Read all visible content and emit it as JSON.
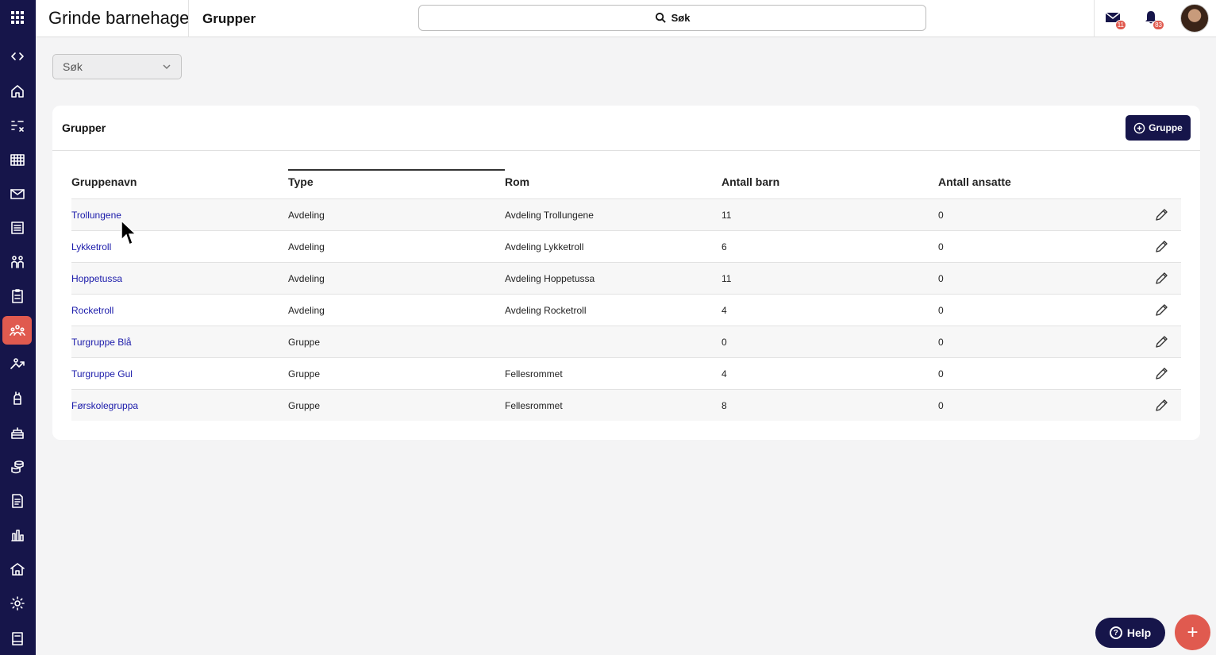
{
  "header": {
    "app_title": "Grinde barnehage",
    "page_title": "Grupper",
    "search_label": "Søk",
    "messages_badge": "11",
    "notifications_badge": "83"
  },
  "filter": {
    "selected": "Søk"
  },
  "card": {
    "title": "Grupper",
    "add_button_label": "Gruppe"
  },
  "table": {
    "columns": [
      "Gruppenavn",
      "Type",
      "Rom",
      "Antall barn",
      "Antall ansatte"
    ],
    "rows": [
      {
        "name": "Trollungene",
        "type": "Avdeling",
        "room": "Avdeling Trollungene",
        "children": "11",
        "staff": "0"
      },
      {
        "name": "Lykketroll",
        "type": "Avdeling",
        "room": "Avdeling Lykketroll",
        "children": "6",
        "staff": "0"
      },
      {
        "name": "Hoppetussa",
        "type": "Avdeling",
        "room": "Avdeling Hoppetussa",
        "children": "11",
        "staff": "0"
      },
      {
        "name": "Rocketroll",
        "type": "Avdeling",
        "room": "Avdeling Rocketroll",
        "children": "4",
        "staff": "0"
      },
      {
        "name": "Turgruppe Blå",
        "type": "Gruppe",
        "room": "",
        "children": "0",
        "staff": "0"
      },
      {
        "name": "Turgruppe Gul",
        "type": "Gruppe",
        "room": "Fellesrommet",
        "children": "4",
        "staff": "0"
      },
      {
        "name": "Førskolegruppa",
        "type": "Gruppe",
        "room": "Fellesrommet",
        "children": "8",
        "staff": "0"
      }
    ]
  },
  "floating": {
    "help_label": "Help",
    "add_symbol": "+"
  },
  "sidebar": {
    "icons": [
      "apps-grid-icon",
      "collapse-toggle-icon",
      "home-icon",
      "tasks-icon",
      "calendar-icon",
      "mail-icon",
      "news-icon",
      "children-icon",
      "checklist-icon",
      "groups-icon",
      "meals-icon",
      "activity-icon",
      "birthday-icon",
      "finance-icon",
      "documents-icon",
      "reports-icon",
      "kindergarten-icon",
      "settings-icon",
      "book-icon"
    ],
    "active": "groups-icon"
  },
  "colors": {
    "primary": "#16154a",
    "accent": "#e05a4f",
    "link": "#1a1aaa"
  }
}
